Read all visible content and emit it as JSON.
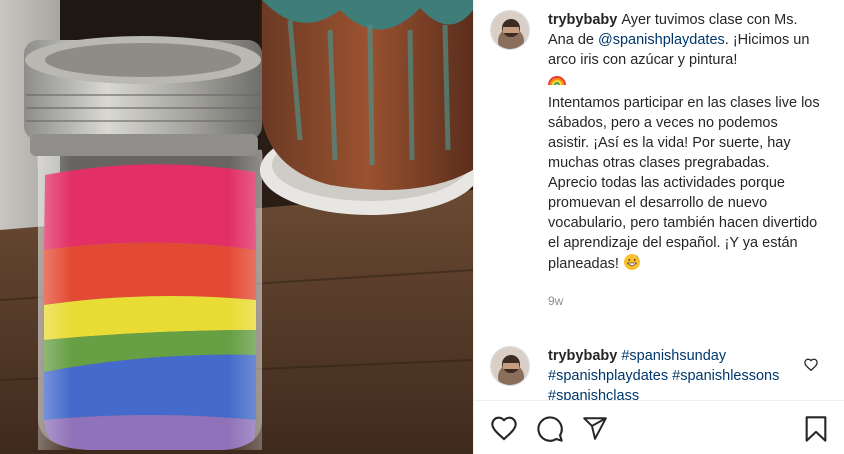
{
  "post": {
    "username": "trybybaby",
    "caption_part1": "Ayer tuvimos clase con Ms. Ana de ",
    "caption_mention": "@spanishplaydates",
    "caption_part2": ". ¡Hicimos un arco iris con azúcar y pintura!",
    "caption_emoji_rainbow": "rainbow-emoji",
    "caption_paragraph2": "Intentamos participar en las clases live los sábados, pero a veces no podemos asistir. ¡Así es la vida! Por suerte, hay muchas otras clases pregrabadas. Aprecio todas las actividades porque promuevan el desarrollo de nuevo vocabulario, pero también hacen divertido el aprendizaje del español. ¡Y ya están planeadas!",
    "caption_emoji_smile": "grinning-sweat-emoji",
    "time": "9w"
  },
  "comment": {
    "username": "trybybaby",
    "hashtag1": "#spanishsunday",
    "hashtag2": "#spanishplaydates",
    "hashtag3": "#spanishlessons",
    "hashtag4": "#spanishclass"
  },
  "icons": {
    "like": "heart-icon",
    "comment": "comment-icon",
    "share": "paper-plane-icon",
    "save": "bookmark-icon",
    "comment_like": "heart-small-icon"
  },
  "colors": {
    "text": "#262626",
    "link": "#00376b",
    "meta": "#8e8e8e",
    "divider": "#efefef"
  }
}
